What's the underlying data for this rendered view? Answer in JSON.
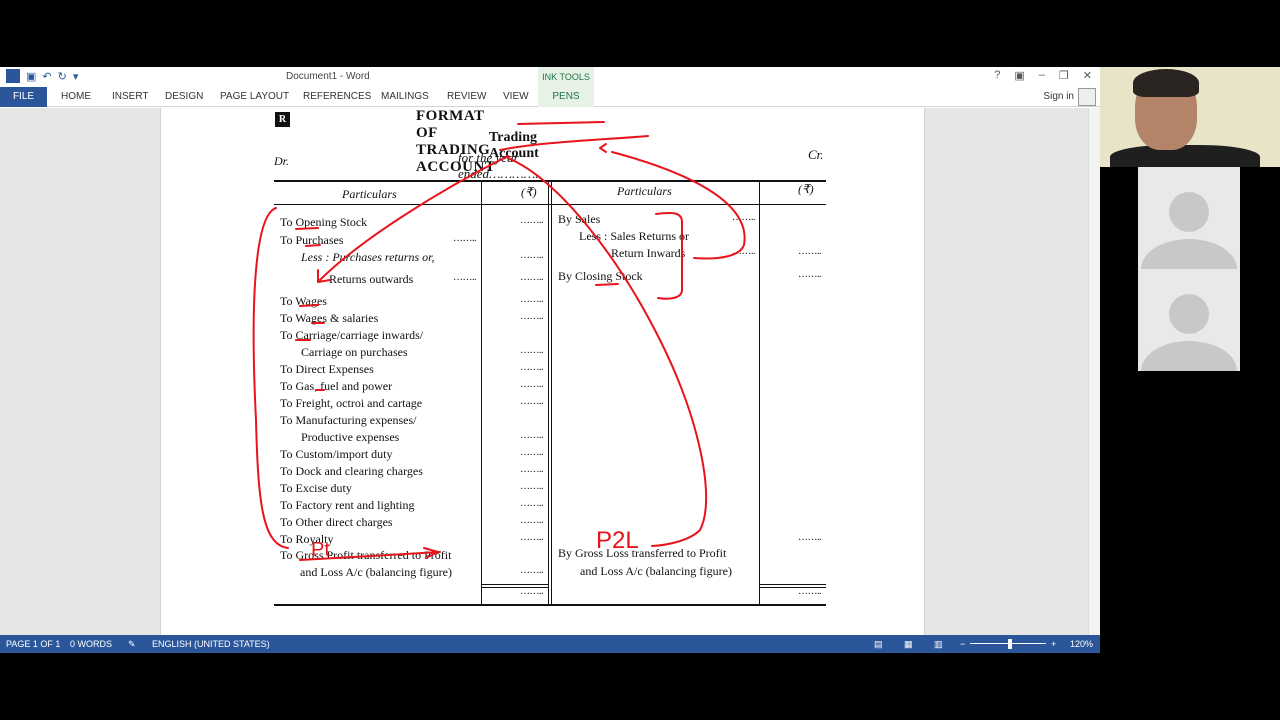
{
  "window": {
    "title": "Document1 - Word",
    "contextual_group": "INK TOOLS",
    "sign_in": "Sign in",
    "controls": [
      "?",
      "▣",
      "–",
      "❐",
      "✕"
    ]
  },
  "ribbon": {
    "tabs": [
      "FILE",
      "HOME",
      "INSERT",
      "DESIGN",
      "PAGE LAYOUT",
      "REFERENCES",
      "MAILINGS",
      "REVIEW",
      "VIEW",
      "PENS"
    ]
  },
  "status": {
    "page": "PAGE 1 OF 1",
    "words": "0 WORDS",
    "language": "ENGLISH (UNITED STATES)",
    "zoom": "120%",
    "zoom_minus": "−",
    "zoom_plus": "+"
  },
  "document": {
    "badge": "R",
    "heading": "FORMAT OF TRADING ACCOUNT",
    "title": "Trading Account",
    "subtitle": "for the year ended…………..",
    "dr": "Dr.",
    "cr": "Cr.",
    "col_particulars": "Particulars",
    "col_amount": "(₹)",
    "dots": "……..",
    "debit_items": [
      "To Opening Stock",
      "To Purchases",
      "Less : Purchases returns or,",
      "Returns outwards",
      "To Wages",
      "To Wages & salaries",
      "To Carriage/carriage inwards/",
      "Carriage on purchases",
      "To Direct Expenses",
      "To Gas, fuel and power",
      "To Freight, octroi and cartage",
      "To Manufacturing expenses/",
      "Productive expenses",
      "To Custom/import duty",
      "To Dock and clearing charges",
      "To Excise duty",
      "To Factory rent and lighting",
      "To Other direct charges",
      "To Royalty",
      "To Gross Profit transferred to Profit",
      "and Loss A/c (balancing figure)"
    ],
    "credit_items": [
      "By Sales",
      "Less : Sales Returns or",
      "Return Inwards",
      "By Closing Stock",
      "By Gross Loss transferred to Profit",
      "and Loss A/c (balancing figure)"
    ]
  },
  "annotations": {
    "handwriting_left": "Pt",
    "handwriting_right": "P2L",
    "color": "#e8141b"
  }
}
